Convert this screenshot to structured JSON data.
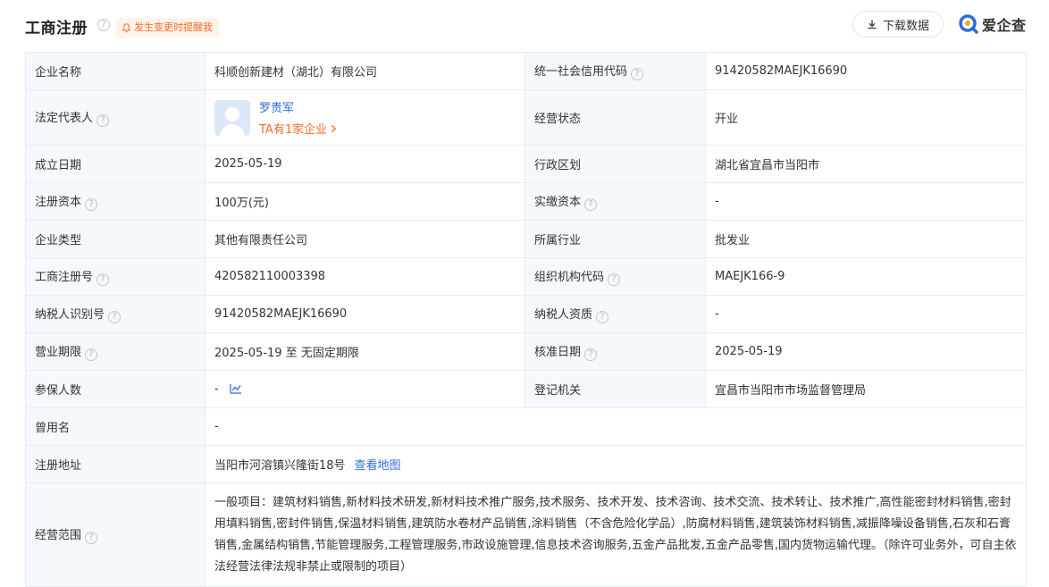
{
  "header": {
    "title": "工商注册",
    "alert_label": "发生变更时提醒我",
    "download_label": "下载数据",
    "logo_text": "爱企查"
  },
  "colors": {
    "accent_blue": "#2e6bd8",
    "accent_orange": "#f26b2b",
    "label_bg": "#f5f8fc",
    "border": "#e8edf3"
  },
  "rows": {
    "company_name": {
      "label": "企业名称",
      "value": "科顺创新建材（湖北）有限公司"
    },
    "credit_code": {
      "label": "统一社会信用代码",
      "value": "91420582MAEJK16690"
    },
    "legal_rep": {
      "label": "法定代表人",
      "name": "罗贵军",
      "link": "TA有1家企业"
    },
    "status": {
      "label": "经营状态",
      "value": "开业"
    },
    "founded": {
      "label": "成立日期",
      "value": "2025-05-19"
    },
    "region": {
      "label": "行政区划",
      "value": "湖北省宜昌市当阳市"
    },
    "reg_capital": {
      "label": "注册资本",
      "value": "100万(元)"
    },
    "paid_capital": {
      "label": "实缴资本",
      "value": "-"
    },
    "company_type": {
      "label": "企业类型",
      "value": "其他有限责任公司"
    },
    "industry": {
      "label": "所属行业",
      "value": "批发业"
    },
    "reg_number": {
      "label": "工商注册号",
      "value": "420582110003398"
    },
    "org_code": {
      "label": "组织机构代码",
      "value": "MAEJK166-9"
    },
    "taxpayer_id": {
      "label": "纳税人识别号",
      "value": "91420582MAEJK16690"
    },
    "taxpayer_qual": {
      "label": "纳税人资质",
      "value": "-"
    },
    "business_term": {
      "label": "营业期限",
      "value": "2025-05-19 至 无固定期限"
    },
    "approval_date": {
      "label": "核准日期",
      "value": "2025-05-19"
    },
    "insured": {
      "label": "参保人数",
      "value": "-"
    },
    "authority": {
      "label": "登记机关",
      "value": "宜昌市当阳市市场监督管理局"
    },
    "former_name": {
      "label": "曾用名",
      "value": "-"
    },
    "address": {
      "label": "注册地址",
      "value": "当阳市河溶镇兴隆街18号",
      "map_link": "查看地图"
    },
    "scope": {
      "label": "经营范围",
      "value": "一般项目：建筑材料销售,新材料技术研发,新材料技术推广服务,技术服务、技术开发、技术咨询、技术交流、技术转让、技术推广,高性能密封材料销售,密封用填料销售,密封件销售,保温材料销售,建筑防水卷材产品销售,涂料销售（不含危险化学品）,防腐材料销售,建筑装饰材料销售,减振降噪设备销售,石灰和石膏销售,金属结构销售,节能管理服务,工程管理服务,市政设施管理,信息技术咨询服务,五金产品批发,五金产品零售,国内货物运输代理。（除许可业务外，可自主依法经营法律法规非禁止或限制的项目）"
    }
  }
}
